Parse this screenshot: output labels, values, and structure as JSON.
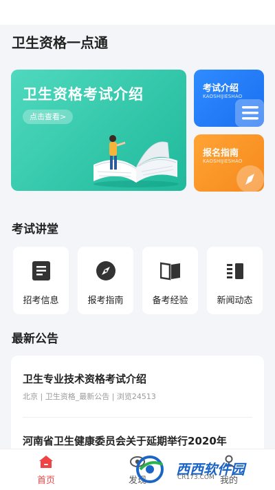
{
  "app": {
    "title": "卫生资格一点通"
  },
  "hero": {
    "title": "卫生资格考试介绍",
    "button": "点击查看>",
    "color": "#2cc6a7"
  },
  "side_cards": [
    {
      "title": "考试介绍",
      "subtitle": "KAOSHIJIESHAO",
      "color": "#2a86ff",
      "icon": "list-icon"
    },
    {
      "title": "报名指南",
      "subtitle": "KAOSHIJIESHAO",
      "color": "#fb9629",
      "icon": "compass-icon"
    }
  ],
  "lecture": {
    "title": "考试讲堂",
    "items": [
      {
        "label": "招考信息",
        "icon": "document-icon"
      },
      {
        "label": "报考指南",
        "icon": "compass-icon"
      },
      {
        "label": "备考经验",
        "icon": "book-icon"
      },
      {
        "label": "新闻动态",
        "icon": "news-icon"
      }
    ]
  },
  "notices": {
    "title": "最新公告",
    "items": [
      {
        "title": "卫生专业技术资格考试介绍",
        "meta": "北京 | 卫生资格_最新公告 | 浏览24513"
      },
      {
        "title": "河南省卫生健康委员会关于延期举行2020年",
        "meta": ""
      }
    ]
  },
  "tabbar": {
    "items": [
      {
        "label": "首页",
        "icon": "home-icon",
        "active": true
      },
      {
        "label": "发现",
        "icon": "eye-icon",
        "active": false
      },
      {
        "label": "我的",
        "icon": "user-icon",
        "active": false
      }
    ],
    "active_color": "#f04444"
  },
  "watermark": {
    "text": "西西软件园",
    "sub": "CR173.COM"
  }
}
